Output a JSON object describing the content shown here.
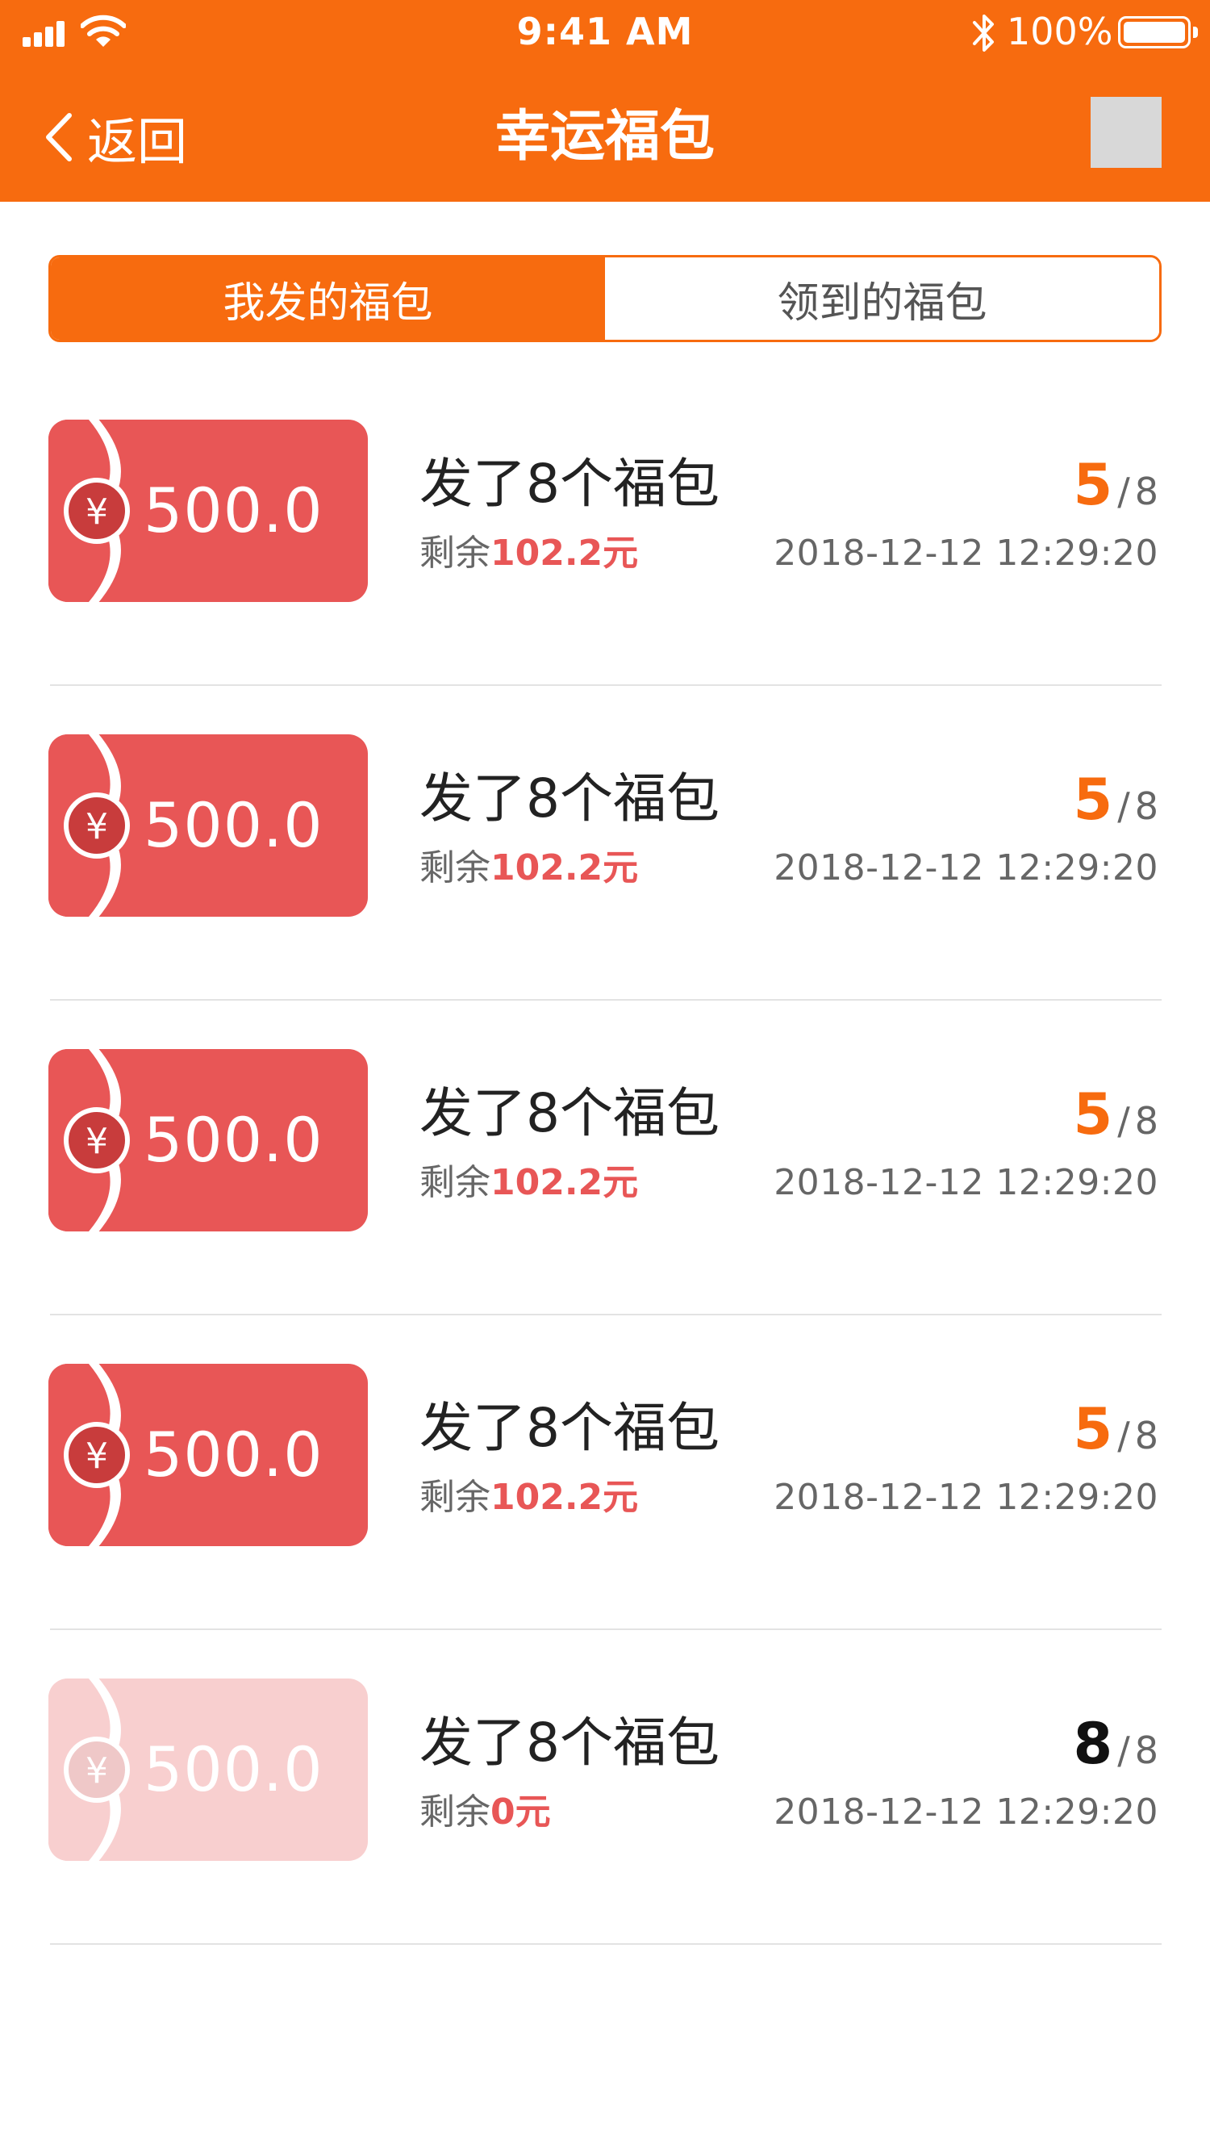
{
  "status_bar": {
    "time": "9:41 AM",
    "battery": "100%"
  },
  "nav": {
    "back_label": "返回",
    "title": "幸运福包"
  },
  "tabs": {
    "sent": "我发的福包",
    "received": "领到的福包"
  },
  "colors": {
    "accent": "#F76B0F",
    "ticket_red": "#E85656",
    "remain_red": "#E85656"
  },
  "currency_symbol": "¥",
  "items": [
    {
      "amount": "500.0",
      "title": "发了8个福包",
      "remain_label": "剩余",
      "remain_value": "102.2元",
      "opened": "5",
      "total": "8",
      "date": "2018-12-12 12:29:20"
    },
    {
      "amount": "500.0",
      "title": "发了8个福包",
      "remain_label": "剩余",
      "remain_value": "102.2元",
      "opened": "5",
      "total": "8",
      "date": "2018-12-12 12:29:20"
    },
    {
      "amount": "500.0",
      "title": "发了8个福包",
      "remain_label": "剩余",
      "remain_value": "102.2元",
      "opened": "5",
      "total": "8",
      "date": "2018-12-12 12:29:20"
    },
    {
      "amount": "500.0",
      "title": "发了8个福包",
      "remain_label": "剩余",
      "remain_value": "102.2元",
      "opened": "5",
      "total": "8",
      "date": "2018-12-12 12:29:20"
    },
    {
      "amount": "500.0",
      "title": "发了8个福包",
      "remain_label": "剩余",
      "remain_value": "0元",
      "opened": "8",
      "total": "8",
      "date": "2018-12-12 12:29:20"
    }
  ]
}
